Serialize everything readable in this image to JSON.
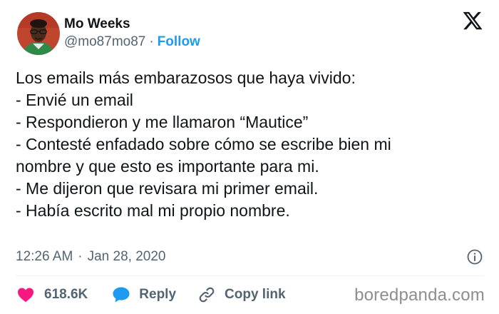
{
  "user": {
    "display_name": "Mo Weeks",
    "handle": "@mo87mo87",
    "separator": "·",
    "follow_label": "Follow"
  },
  "tweet": {
    "lines": [
      "Los emails más embarazosos que haya vivido:",
      "- Envié un email",
      "- Respondieron y me llamaron “Mautice”",
      "- Contesté enfadado sobre cómo se escribe bien mi",
      "nombre y que esto es importante para mi.",
      "- Me dijeron que revisara mi primer email.",
      "- Había escrito mal mi propio nombre."
    ],
    "time": "12:26 AM",
    "separator": "·",
    "date": "Jan 28, 2020"
  },
  "actions": {
    "like_count": "618.6K",
    "reply_label": "Reply",
    "copy_label": "Copy link"
  },
  "watermark": "boredpanda.com",
  "icons": {
    "avatar": "avatar",
    "brand": "x-logo-icon",
    "info": "info-icon",
    "like": "heart-icon",
    "reply": "speech-bubble-icon",
    "copy": "link-icon"
  },
  "colors": {
    "accent": "#1d9bf0",
    "like": "#f91880",
    "muted": "#536471",
    "text": "#0f1419"
  }
}
